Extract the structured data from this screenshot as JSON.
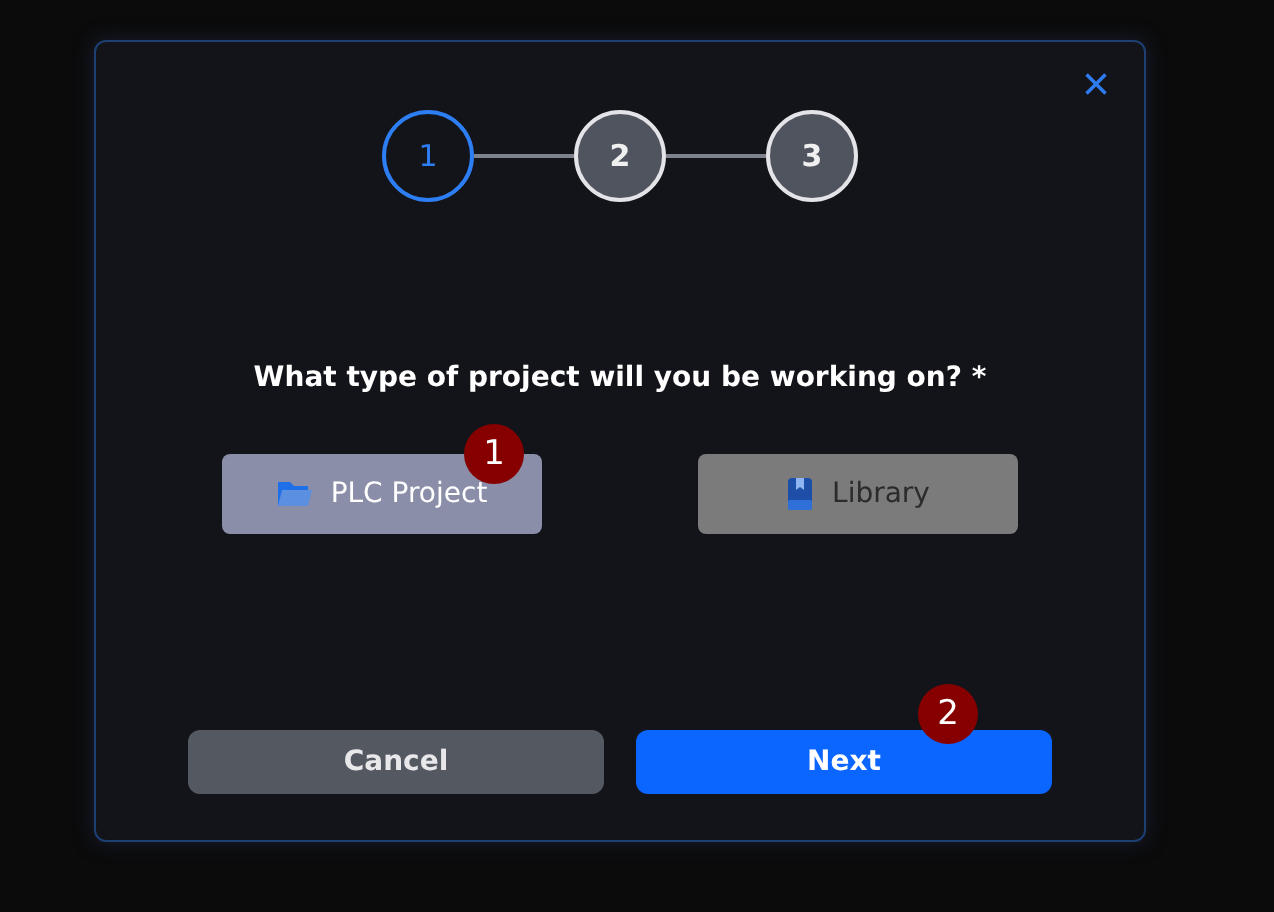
{
  "dialog": {
    "close": "×"
  },
  "steps": [
    {
      "label": "1",
      "selected": true
    },
    {
      "label": "2",
      "selected": false
    },
    {
      "label": "3",
      "selected": false
    }
  ],
  "question": "What type of project will you be working on? *",
  "options": [
    {
      "label": "PLC Project",
      "kind": "project",
      "selected": true,
      "marker": "1"
    },
    {
      "label": "Library",
      "kind": "library",
      "selected": false
    }
  ],
  "buttons": [
    {
      "label": "Cancel",
      "kind": "secondary"
    },
    {
      "label": "Next",
      "kind": "primary",
      "marker": "2"
    }
  ]
}
